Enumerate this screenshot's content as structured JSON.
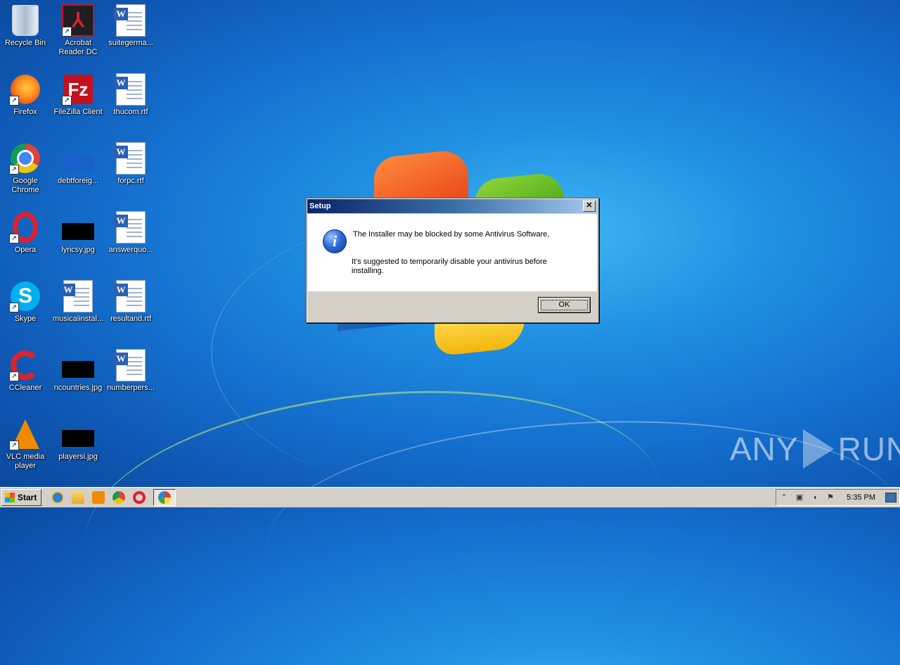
{
  "desktop": {
    "icons": [
      {
        "label": "Recycle Bin"
      },
      {
        "label": "Acrobat Reader DC"
      },
      {
        "label": "suitegerma..."
      },
      {
        "label": "Firefox"
      },
      {
        "label": "FileZilla Client"
      },
      {
        "label": "thucom.rtf"
      },
      {
        "label": "Google Chrome"
      },
      {
        "label": "debtforeig..."
      },
      {
        "label": "forpc.rtf"
      },
      {
        "label": "Opera"
      },
      {
        "label": "lyricsy.jpg"
      },
      {
        "label": "answerquo..."
      },
      {
        "label": "Skype"
      },
      {
        "label": "musicalinstal..."
      },
      {
        "label": "resultand.rtf"
      },
      {
        "label": "CCleaner"
      },
      {
        "label": "ncountries.jpg"
      },
      {
        "label": "numberpers..."
      },
      {
        "label": "VLC media player"
      },
      {
        "label": "playersi.jpg"
      }
    ]
  },
  "dialog": {
    "title": "Setup",
    "close_glyph": "✕",
    "icon": "info-icon",
    "line1": "The Installer may be blocked by some Antivirus Software,",
    "line2": "It's suggested to temporarily disable your antivirus before installing.",
    "ok_label": "OK"
  },
  "taskbar": {
    "start_label": "Start",
    "quick_launch": [
      "ie-icon",
      "folder-icon",
      "media-player-icon",
      "chrome-icon",
      "opera-icon"
    ],
    "active_task": "colorful-app-icon",
    "clock": "5:35 PM"
  },
  "watermark": {
    "left": "ANY",
    "right": "RUN"
  },
  "colors": {
    "titlebar_start": "#0a246a",
    "titlebar_end": "#a6caf0",
    "desktop_blue": "#1570cf"
  }
}
